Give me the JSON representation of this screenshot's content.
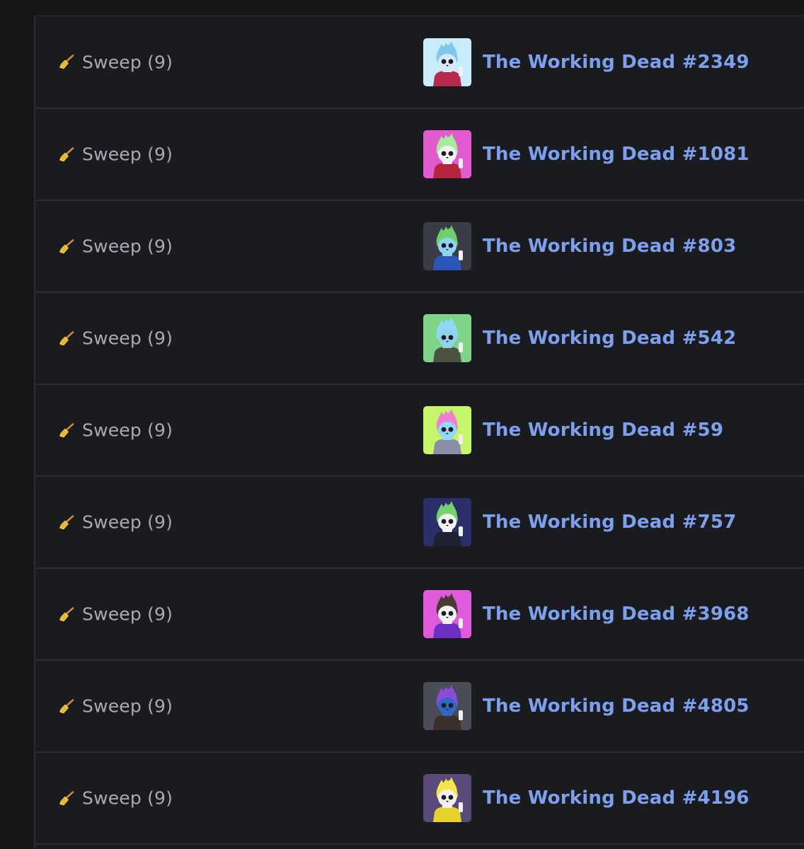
{
  "rows": [
    {
      "event_label": "Sweep (9)",
      "item_name": "The Working Dead #2349",
      "thumb": {
        "bg": "#c9ecfa",
        "flame": "#7ec8f0",
        "skull": "#d9e8f6",
        "suit": "#b7294d"
      }
    },
    {
      "event_label": "Sweep (9)",
      "item_name": "The Working Dead #1081",
      "thumb": {
        "bg": "#e25ad0",
        "flame": "#a7eb9c",
        "skull": "#f1f1f1",
        "suit": "#b3263d"
      }
    },
    {
      "event_label": "Sweep (9)",
      "item_name": "The Working Dead #803",
      "thumb": {
        "bg": "#3a3d45",
        "flame": "#6fd06a",
        "skull": "#8fd4f2",
        "suit": "#2b58b8"
      }
    },
    {
      "event_label": "Sweep (9)",
      "item_name": "The Working Dead #542",
      "thumb": {
        "bg": "#7fd487",
        "flame": "#8fd8f6",
        "skull": "#8fd2ea",
        "suit": "#4b5440"
      }
    },
    {
      "event_label": "Sweep (9)",
      "item_name": "The Working Dead #59",
      "thumb": {
        "bg": "#c6f56a",
        "flame": "#ef7fd2",
        "skull": "#8fd8f6",
        "suit": "#8a8fa8"
      }
    },
    {
      "event_label": "Sweep (9)",
      "item_name": "The Working Dead #757",
      "thumb": {
        "bg": "#2a2f6a",
        "flame": "#75d36c",
        "skull": "#f1f1f1",
        "suit": "#1f2230"
      }
    },
    {
      "event_label": "Sweep (9)",
      "item_name": "The Working Dead #3968",
      "thumb": {
        "bg": "#e05bdc",
        "flame": "#4a3a33",
        "skull": "#f1f1f1",
        "suit": "#6b2fc2"
      }
    },
    {
      "event_label": "Sweep (9)",
      "item_name": "The Working Dead #4805",
      "thumb": {
        "bg": "#4a4d56",
        "flame": "#8a4bd6",
        "skull": "#2f67c4",
        "suit": "#3a2f2a"
      }
    },
    {
      "event_label": "Sweep (9)",
      "item_name": "The Working Dead #4196",
      "thumb": {
        "bg": "#5a4a7a",
        "flame": "#f4e64a",
        "skull": "#f1f1f1",
        "suit": "#e7d22a"
      }
    }
  ]
}
